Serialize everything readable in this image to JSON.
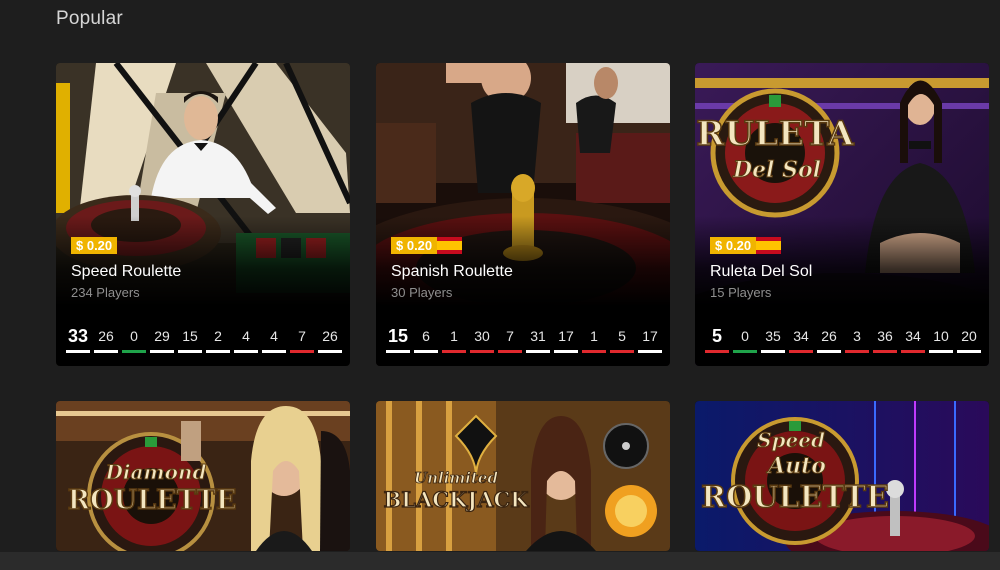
{
  "section": {
    "title": "Popular"
  },
  "cards": [
    {
      "name": "Speed Roulette",
      "players": "234 Players",
      "bet": "$ 0.20",
      "flag": false,
      "results": [
        {
          "v": "33",
          "c": "black"
        },
        {
          "v": "26",
          "c": "black"
        },
        {
          "v": "0",
          "c": "green"
        },
        {
          "v": "29",
          "c": "black"
        },
        {
          "v": "15",
          "c": "black"
        },
        {
          "v": "2",
          "c": "black"
        },
        {
          "v": "4",
          "c": "black"
        },
        {
          "v": "4",
          "c": "black"
        },
        {
          "v": "7",
          "c": "red"
        },
        {
          "v": "26",
          "c": "black"
        }
      ]
    },
    {
      "name": "Spanish Roulette",
      "players": "30 Players",
      "bet": "$ 0.20",
      "flag": true,
      "results": [
        {
          "v": "15",
          "c": "black"
        },
        {
          "v": "6",
          "c": "black"
        },
        {
          "v": "1",
          "c": "red"
        },
        {
          "v": "30",
          "c": "red"
        },
        {
          "v": "7",
          "c": "red"
        },
        {
          "v": "31",
          "c": "black"
        },
        {
          "v": "17",
          "c": "black"
        },
        {
          "v": "1",
          "c": "red"
        },
        {
          "v": "5",
          "c": "red"
        },
        {
          "v": "17",
          "c": "black"
        }
      ]
    },
    {
      "name": "Ruleta Del Sol",
      "players": "15 Players",
      "bet": "$ 0.20",
      "flag": true,
      "results": [
        {
          "v": "5",
          "c": "red"
        },
        {
          "v": "0",
          "c": "green"
        },
        {
          "v": "35",
          "c": "black"
        },
        {
          "v": "34",
          "c": "red"
        },
        {
          "v": "26",
          "c": "black"
        },
        {
          "v": "3",
          "c": "red"
        },
        {
          "v": "36",
          "c": "red"
        },
        {
          "v": "34",
          "c": "red"
        },
        {
          "v": "10",
          "c": "black"
        },
        {
          "v": "20",
          "c": "black"
        }
      ]
    }
  ],
  "logos": {
    "ruleta_line1": "RULETA",
    "ruleta_line2": "Del Sol",
    "diamond_line1": "Diamond",
    "diamond_line2": "ROULETTE",
    "blackjack_line1": "Unlimited",
    "blackjack_line2": "BLACKJACK",
    "speed_line1": "Speed",
    "speed_line2": "Auto",
    "speed_line3": "ROULETTE"
  },
  "colors": {
    "bet_badge": "#f0b400",
    "red": "#e0292e",
    "green": "#1fa34a",
    "black": "#ffffff"
  }
}
